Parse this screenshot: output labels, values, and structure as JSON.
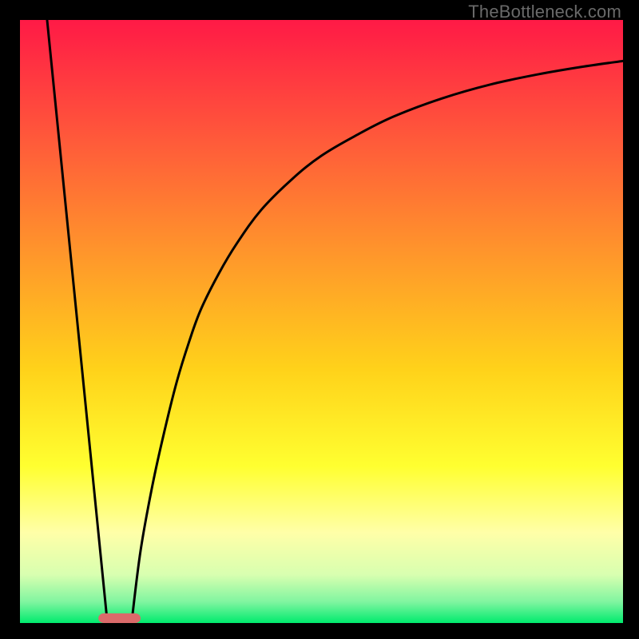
{
  "watermark": "TheBottleneck.com",
  "chart_data": {
    "type": "line",
    "title": "",
    "xlabel": "",
    "ylabel": "",
    "xlim": [
      0,
      100
    ],
    "ylim": [
      0,
      100
    ],
    "grid": false,
    "legend": false,
    "background_gradient": {
      "stops": [
        {
          "pos": 0.0,
          "color": "#ff1a46"
        },
        {
          "pos": 0.2,
          "color": "#ff5a3a"
        },
        {
          "pos": 0.4,
          "color": "#ff9a2a"
        },
        {
          "pos": 0.58,
          "color": "#ffd21a"
        },
        {
          "pos": 0.74,
          "color": "#ffff30"
        },
        {
          "pos": 0.85,
          "color": "#ffffa8"
        },
        {
          "pos": 0.92,
          "color": "#d8ffb0"
        },
        {
          "pos": 0.965,
          "color": "#80f5a0"
        },
        {
          "pos": 1.0,
          "color": "#00eb6e"
        }
      ]
    },
    "marker": {
      "x": 16.5,
      "y": 0.8,
      "width": 7,
      "height": 1.6,
      "color": "#db6a6a",
      "rx": 0.9
    },
    "series": [
      {
        "name": "left-line",
        "x": [
          4.5,
          14.5
        ],
        "y": [
          100,
          0
        ]
      },
      {
        "name": "right-curve",
        "x": [
          18.5,
          20,
          22,
          24,
          26,
          28,
          30,
          33,
          36,
          40,
          45,
          50,
          56,
          62,
          70,
          78,
          86,
          93,
          100
        ],
        "y": [
          0,
          12,
          23,
          32,
          40,
          46.5,
          52,
          58,
          63,
          68.5,
          73.5,
          77.5,
          81,
          84,
          87,
          89.3,
          91,
          92.2,
          93.2
        ]
      }
    ]
  }
}
